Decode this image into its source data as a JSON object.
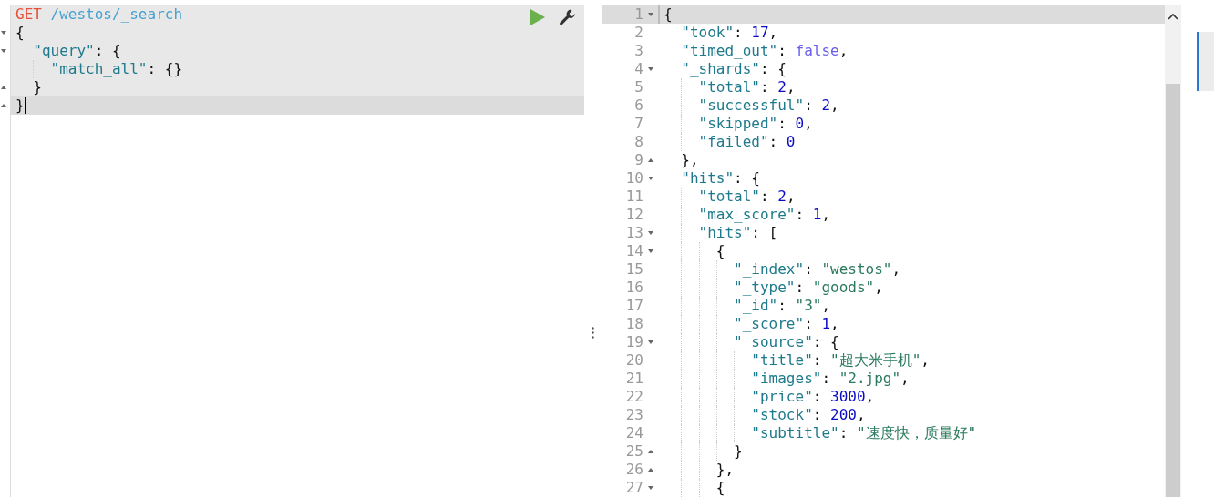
{
  "request": {
    "lines": [
      {
        "fold_start": false,
        "fold_end": false,
        "active": false,
        "tokens": [
          {
            "kind": "method",
            "text": "GET"
          },
          {
            "kind": "path",
            "text": "/westos/_search"
          }
        ]
      },
      {
        "fold_start": true,
        "fold_end": false,
        "active": false,
        "tokens": [
          {
            "kind": "punct",
            "text": "{"
          }
        ]
      },
      {
        "fold_start": true,
        "fold_end": false,
        "active": false,
        "tokens": [
          {
            "kind": "key",
            "text": "  \"query\""
          },
          {
            "kind": "punct",
            "text": ": {"
          }
        ]
      },
      {
        "fold_start": false,
        "fold_end": false,
        "active": false,
        "tokens": [
          {
            "kind": "key",
            "text": "    \"match_all\""
          },
          {
            "kind": "punct",
            "text": ": {}"
          }
        ]
      },
      {
        "fold_start": false,
        "fold_end": true,
        "active": false,
        "tokens": [
          {
            "kind": "punct",
            "text": "  }"
          }
        ]
      },
      {
        "fold_start": false,
        "fold_end": true,
        "active": true,
        "tokens": [
          {
            "kind": "punct",
            "text": "}"
          }
        ]
      }
    ]
  },
  "response": {
    "lines": [
      {
        "number": "1",
        "fold_start": true,
        "fold_end": false,
        "active": true,
        "tokens": [
          {
            "kind": "punct",
            "text": "{"
          }
        ]
      },
      {
        "number": "2",
        "fold_start": false,
        "fold_end": false,
        "active": false,
        "tokens": [
          {
            "kind": "key",
            "text": "  \"took\""
          },
          {
            "kind": "punct",
            "text": ": "
          },
          {
            "kind": "number",
            "text": "17"
          },
          {
            "kind": "punct",
            "text": ","
          }
        ]
      },
      {
        "number": "3",
        "fold_start": false,
        "fold_end": false,
        "active": false,
        "tokens": [
          {
            "kind": "key",
            "text": "  \"timed_out\""
          },
          {
            "kind": "punct",
            "text": ": "
          },
          {
            "kind": "bool",
            "text": "false"
          },
          {
            "kind": "punct",
            "text": ","
          }
        ]
      },
      {
        "number": "4",
        "fold_start": true,
        "fold_end": false,
        "active": false,
        "tokens": [
          {
            "kind": "key",
            "text": "  \"_shards\""
          },
          {
            "kind": "punct",
            "text": ": {"
          }
        ]
      },
      {
        "number": "5",
        "fold_start": false,
        "fold_end": false,
        "active": false,
        "tokens": [
          {
            "kind": "key",
            "text": "    \"total\""
          },
          {
            "kind": "punct",
            "text": ": "
          },
          {
            "kind": "number",
            "text": "2"
          },
          {
            "kind": "punct",
            "text": ","
          }
        ]
      },
      {
        "number": "6",
        "fold_start": false,
        "fold_end": false,
        "active": false,
        "tokens": [
          {
            "kind": "key",
            "text": "    \"successful\""
          },
          {
            "kind": "punct",
            "text": ": "
          },
          {
            "kind": "number",
            "text": "2"
          },
          {
            "kind": "punct",
            "text": ","
          }
        ]
      },
      {
        "number": "7",
        "fold_start": false,
        "fold_end": false,
        "active": false,
        "tokens": [
          {
            "kind": "key",
            "text": "    \"skipped\""
          },
          {
            "kind": "punct",
            "text": ": "
          },
          {
            "kind": "number",
            "text": "0"
          },
          {
            "kind": "punct",
            "text": ","
          }
        ]
      },
      {
        "number": "8",
        "fold_start": false,
        "fold_end": false,
        "active": false,
        "tokens": [
          {
            "kind": "key",
            "text": "    \"failed\""
          },
          {
            "kind": "punct",
            "text": ": "
          },
          {
            "kind": "number",
            "text": "0"
          }
        ]
      },
      {
        "number": "9",
        "fold_start": false,
        "fold_end": true,
        "active": false,
        "tokens": [
          {
            "kind": "punct",
            "text": "  },"
          }
        ]
      },
      {
        "number": "10",
        "fold_start": true,
        "fold_end": false,
        "active": false,
        "tokens": [
          {
            "kind": "key",
            "text": "  \"hits\""
          },
          {
            "kind": "punct",
            "text": ": {"
          }
        ]
      },
      {
        "number": "11",
        "fold_start": false,
        "fold_end": false,
        "active": false,
        "tokens": [
          {
            "kind": "key",
            "text": "    \"total\""
          },
          {
            "kind": "punct",
            "text": ": "
          },
          {
            "kind": "number",
            "text": "2"
          },
          {
            "kind": "punct",
            "text": ","
          }
        ]
      },
      {
        "number": "12",
        "fold_start": false,
        "fold_end": false,
        "active": false,
        "tokens": [
          {
            "kind": "key",
            "text": "    \"max_score\""
          },
          {
            "kind": "punct",
            "text": ": "
          },
          {
            "kind": "number",
            "text": "1"
          },
          {
            "kind": "punct",
            "text": ","
          }
        ]
      },
      {
        "number": "13",
        "fold_start": true,
        "fold_end": false,
        "active": false,
        "tokens": [
          {
            "kind": "key",
            "text": "    \"hits\""
          },
          {
            "kind": "punct",
            "text": ": ["
          }
        ]
      },
      {
        "number": "14",
        "fold_start": true,
        "fold_end": false,
        "active": false,
        "tokens": [
          {
            "kind": "punct",
            "text": "      {"
          }
        ]
      },
      {
        "number": "15",
        "fold_start": false,
        "fold_end": false,
        "active": false,
        "tokens": [
          {
            "kind": "key",
            "text": "        \"_index\""
          },
          {
            "kind": "punct",
            "text": ": "
          },
          {
            "kind": "string",
            "text": "\"westos\""
          },
          {
            "kind": "punct",
            "text": ","
          }
        ]
      },
      {
        "number": "16",
        "fold_start": false,
        "fold_end": false,
        "active": false,
        "tokens": [
          {
            "kind": "key",
            "text": "        \"_type\""
          },
          {
            "kind": "punct",
            "text": ": "
          },
          {
            "kind": "string",
            "text": "\"goods\""
          },
          {
            "kind": "punct",
            "text": ","
          }
        ]
      },
      {
        "number": "17",
        "fold_start": false,
        "fold_end": false,
        "active": false,
        "tokens": [
          {
            "kind": "key",
            "text": "        \"_id\""
          },
          {
            "kind": "punct",
            "text": ": "
          },
          {
            "kind": "string",
            "text": "\"3\""
          },
          {
            "kind": "punct",
            "text": ","
          }
        ]
      },
      {
        "number": "18",
        "fold_start": false,
        "fold_end": false,
        "active": false,
        "tokens": [
          {
            "kind": "key",
            "text": "        \"_score\""
          },
          {
            "kind": "punct",
            "text": ": "
          },
          {
            "kind": "number",
            "text": "1"
          },
          {
            "kind": "punct",
            "text": ","
          }
        ]
      },
      {
        "number": "19",
        "fold_start": true,
        "fold_end": false,
        "active": false,
        "tokens": [
          {
            "kind": "key",
            "text": "        \"_source\""
          },
          {
            "kind": "punct",
            "text": ": {"
          }
        ]
      },
      {
        "number": "20",
        "fold_start": false,
        "fold_end": false,
        "active": false,
        "tokens": [
          {
            "kind": "key",
            "text": "          \"title\""
          },
          {
            "kind": "punct",
            "text": ": "
          },
          {
            "kind": "string",
            "text": "\"超大米手机\""
          },
          {
            "kind": "punct",
            "text": ","
          }
        ]
      },
      {
        "number": "21",
        "fold_start": false,
        "fold_end": false,
        "active": false,
        "tokens": [
          {
            "kind": "key",
            "text": "          \"images\""
          },
          {
            "kind": "punct",
            "text": ": "
          },
          {
            "kind": "string",
            "text": "\"2.jpg\""
          },
          {
            "kind": "punct",
            "text": ","
          }
        ]
      },
      {
        "number": "22",
        "fold_start": false,
        "fold_end": false,
        "active": false,
        "tokens": [
          {
            "kind": "key",
            "text": "          \"price\""
          },
          {
            "kind": "punct",
            "text": ": "
          },
          {
            "kind": "number",
            "text": "3000"
          },
          {
            "kind": "punct",
            "text": ","
          }
        ]
      },
      {
        "number": "23",
        "fold_start": false,
        "fold_end": false,
        "active": false,
        "tokens": [
          {
            "kind": "key",
            "text": "          \"stock\""
          },
          {
            "kind": "punct",
            "text": ": "
          },
          {
            "kind": "number",
            "text": "200"
          },
          {
            "kind": "punct",
            "text": ","
          }
        ]
      },
      {
        "number": "24",
        "fold_start": false,
        "fold_end": false,
        "active": false,
        "tokens": [
          {
            "kind": "key",
            "text": "          \"subtitle\""
          },
          {
            "kind": "punct",
            "text": ": "
          },
          {
            "kind": "string",
            "text": "\"速度快，质量好\""
          }
        ]
      },
      {
        "number": "25",
        "fold_start": false,
        "fold_end": true,
        "active": false,
        "tokens": [
          {
            "kind": "punct",
            "text": "        }"
          }
        ]
      },
      {
        "number": "26",
        "fold_start": false,
        "fold_end": true,
        "active": false,
        "tokens": [
          {
            "kind": "punct",
            "text": "      },"
          }
        ]
      },
      {
        "number": "27",
        "fold_start": true,
        "fold_end": false,
        "active": false,
        "tokens": [
          {
            "kind": "punct",
            "text": "      {"
          }
        ]
      }
    ]
  }
}
